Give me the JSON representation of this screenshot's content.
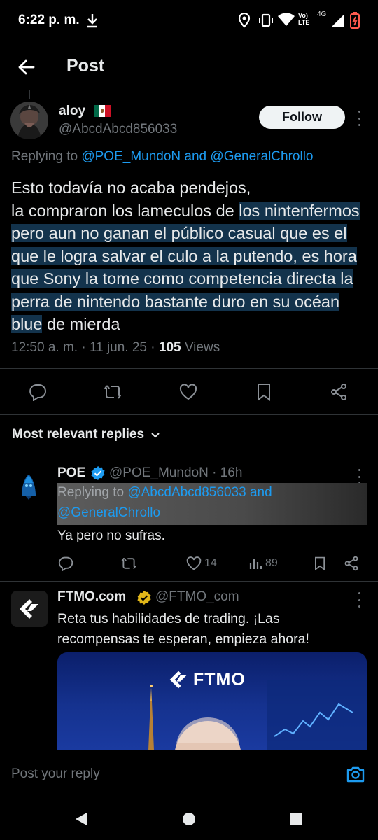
{
  "status_bar": {
    "time": "6:22 p. m.",
    "network_label": "Vo) LTE",
    "signal_label": "4G"
  },
  "header": {
    "title": "Post"
  },
  "post": {
    "author_name": "aloy",
    "author_handle": "@AbcdAbcd856033",
    "follow_label": "Follow",
    "replying_prefix": "Replying to",
    "replying_user1": "@POE_MundoN",
    "replying_and": "and",
    "replying_user2": "@GeneralChrollo",
    "body_line1": "Esto todavía no acaba pendejos,",
    "body_line2a": "la compraron los lameculos de ",
    "body_highlight": "los nintenfermos pero aun no ganan el público casual que es el que le logra salvar el culo a la putendo, es hora que Sony la tome como competencia directa la perra de nintendo bastante duro en su océan blue",
    "body_tail": " de mierda",
    "time": "12:50 a. m. · 11 jun. 25 · ",
    "views_count": "105",
    "views_label": " Views"
  },
  "replies_sort": {
    "label": "Most relevant replies"
  },
  "reply": {
    "author_name": "POE",
    "author_handle": "@POE_MundoN · 16h",
    "replying_prefix": "Replying to",
    "replying_user1": "@AbcdAbcd856033",
    "replying_and": "and",
    "replying_user2": "@GeneralChrollo",
    "text": "Ya pero no sufras.",
    "like_count": "14",
    "views_count": "89"
  },
  "ad": {
    "author_name": "FTMO.com",
    "author_handle": "@FTMO_com",
    "text": "Reta tus habilidades de trading. ¡Las recompensas te esperan, empieza ahora!",
    "media_brand": "FTMO"
  },
  "compose": {
    "placeholder": "Post your reply"
  },
  "colors": {
    "background": "#000000",
    "accent": "#1d9bf0",
    "muted": "#71767b",
    "highlight": "#13334c",
    "gold_badge": "#e2b719"
  }
}
